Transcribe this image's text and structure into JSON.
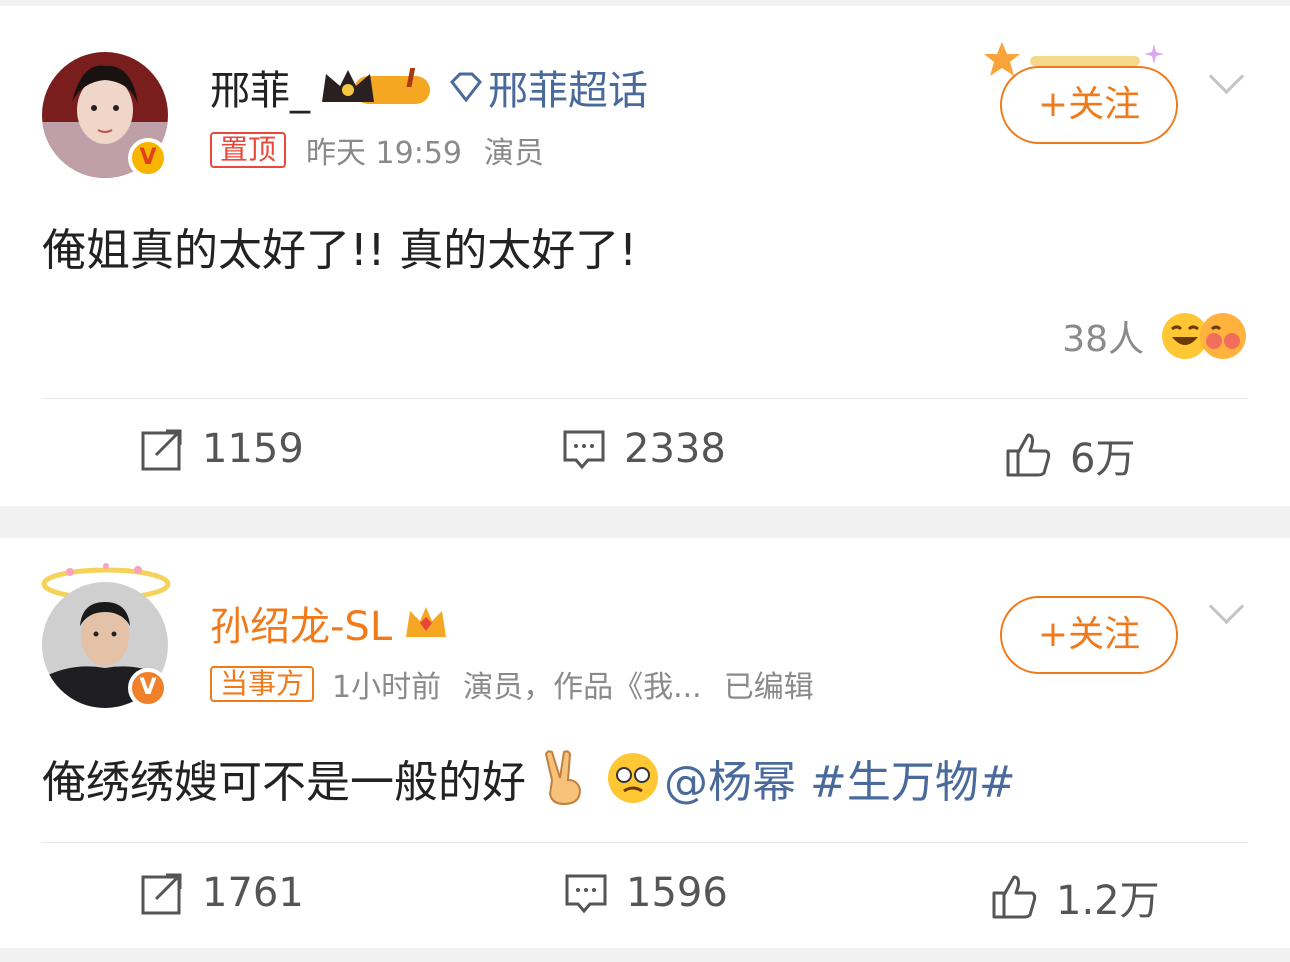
{
  "posts": [
    {
      "username": "邢菲_",
      "level_badge": "I",
      "supertopic": "邢菲超话",
      "tag": "置顶",
      "time": "昨天 19:59",
      "role": "演员",
      "follow_label": "+关注",
      "text": "俺姐真的太好了!! 真的太好了!",
      "reactions_count": "38人",
      "reposts": "1159",
      "comments": "2338",
      "likes": "6万"
    },
    {
      "username": "孙绍龙-SL",
      "tag": "当事方",
      "time": "1小时前",
      "role": "演员，作品《我...",
      "edited": "已编辑",
      "follow_label": "+关注",
      "text_prefix": "俺绣绣嫂可不是一般的好",
      "mention": "@杨幂",
      "hashtag": "#生万物#",
      "reposts": "1761",
      "comments": "1596",
      "likes": "1.2万"
    }
  ],
  "colors": {
    "accent_orange": "#f07a1a",
    "pin_red": "#e8473a",
    "link_blue": "#4a6a9c",
    "username_orange": "#f07a1a"
  },
  "icons": [
    "repost-icon",
    "comment-icon",
    "like-icon",
    "vip-crown-icon",
    "diamond-icon",
    "victory-hand-icon",
    "laughing-emoji-icon",
    "verified-badge-icon",
    "chevron-down-icon"
  ]
}
